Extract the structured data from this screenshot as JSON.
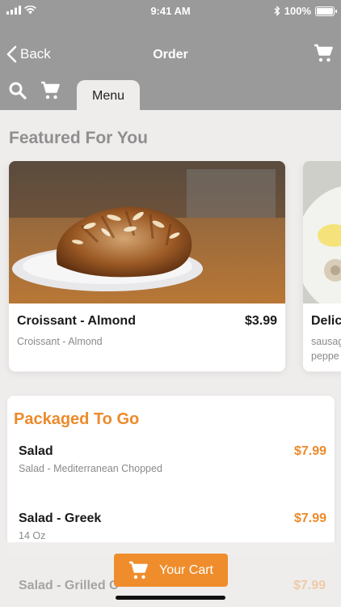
{
  "status": {
    "time": "9:41 AM",
    "battery": "100%"
  },
  "nav": {
    "back_label": "Back",
    "title": "Order"
  },
  "tabs": {
    "menu_label": "Menu"
  },
  "featured": {
    "title": "Featured For You",
    "items": [
      {
        "name": "Croissant - Almond",
        "price": "$3.99",
        "desc": "Croissant - Almond"
      },
      {
        "name": "Delic",
        "desc_line1": "sausag",
        "desc_line2": "peppe"
      }
    ]
  },
  "packaged": {
    "title": "Packaged To Go",
    "items": [
      {
        "name": "Salad",
        "price": "$7.99",
        "desc": "Salad - Mediterranean Chopped"
      },
      {
        "name": "Salad - Greek",
        "price": "$7.99",
        "desc": "14 Oz"
      },
      {
        "name": "Salad - Grilled C",
        "price": "$7.99"
      }
    ]
  },
  "cart_button": {
    "label": "Your Cart"
  },
  "colors": {
    "accent": "#ef8d2c",
    "header": "#9a9a9a",
    "background": "#efedec"
  },
  "icons": [
    "signal-icon",
    "wifi-icon",
    "bluetooth-icon",
    "battery-icon",
    "chevron-left-icon",
    "cart-icon",
    "search-icon"
  ]
}
